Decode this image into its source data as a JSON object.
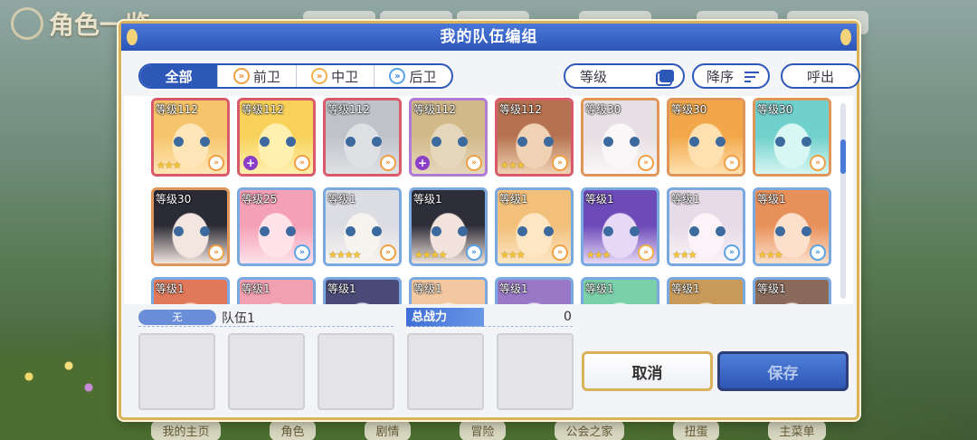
{
  "background": {
    "title": "角色一览",
    "bottom_nav": [
      "我的主页",
      "角色",
      "剧情",
      "冒险",
      "公会之家",
      "扭蛋",
      "主菜单"
    ]
  },
  "dialog": {
    "title": "我的队伍编组",
    "filter_tabs": [
      "全部",
      "前卫",
      "中卫",
      "后卫"
    ],
    "sort_field": "等级",
    "sort_order": "降序",
    "call_button": "呼出",
    "cards": [
      {
        "level": "等级112",
        "stars": "★★★",
        "pos": "front",
        "frame": "red",
        "plus": false
      },
      {
        "level": "等级112",
        "stars": "",
        "pos": "front",
        "frame": "red",
        "plus": true
      },
      {
        "level": "等级112",
        "stars": "",
        "pos": "front",
        "frame": "red",
        "plus": false,
        "dim": true
      },
      {
        "level": "等级112",
        "stars": "",
        "pos": "front",
        "frame": "purple",
        "plus": true,
        "dim": true
      },
      {
        "level": "等级112",
        "stars": "★★★",
        "pos": "front",
        "frame": "red",
        "plus": false
      },
      {
        "level": "等级30",
        "stars": "",
        "pos": "front",
        "frame": "orange",
        "plus": false
      },
      {
        "level": "等级30",
        "stars": "",
        "pos": "front",
        "frame": "orange",
        "plus": false
      },
      {
        "level": "等级30",
        "stars": "",
        "pos": "front",
        "frame": "orange",
        "plus": false
      },
      {
        "level": "等级30",
        "stars": "",
        "pos": "front",
        "frame": "orange",
        "plus": false
      },
      {
        "level": "等级25",
        "stars": "",
        "pos": "back",
        "frame": "blue",
        "plus": false
      },
      {
        "level": "等级1",
        "stars": "★★★★",
        "pos": "front",
        "frame": "blue",
        "plus": false
      },
      {
        "level": "等级1",
        "stars": "★★★★",
        "pos": "back",
        "frame": "blue",
        "plus": false
      },
      {
        "level": "等级1",
        "stars": "★★★",
        "pos": "front",
        "frame": "blue",
        "plus": false
      },
      {
        "level": "等级1",
        "stars": "★★★",
        "pos": "mid",
        "frame": "blue",
        "plus": false
      },
      {
        "level": "等级1",
        "stars": "★★★",
        "pos": "back",
        "frame": "blue",
        "plus": false
      },
      {
        "level": "等级1",
        "stars": "★★★",
        "pos": "back",
        "frame": "blue",
        "plus": false
      },
      {
        "level": "等级1",
        "stars": "",
        "pos": "",
        "frame": "blue",
        "plus": false
      },
      {
        "level": "等级1",
        "stars": "",
        "pos": "",
        "frame": "blue",
        "plus": false
      },
      {
        "level": "等级1",
        "stars": "",
        "pos": "",
        "frame": "blue",
        "plus": false
      },
      {
        "level": "等级1",
        "stars": "",
        "pos": "",
        "frame": "blue",
        "plus": false
      },
      {
        "level": "等级1",
        "stars": "",
        "pos": "",
        "frame": "blue",
        "plus": false
      },
      {
        "level": "等级1",
        "stars": "",
        "pos": "",
        "frame": "blue",
        "plus": false
      },
      {
        "level": "等级1",
        "stars": "",
        "pos": "",
        "frame": "blue",
        "plus": false
      },
      {
        "level": "等级1",
        "stars": "",
        "pos": "",
        "frame": "blue",
        "plus": false
      }
    ],
    "team": {
      "tag": "无",
      "name": "队伍1",
      "power_label": "总战力",
      "power_value": "0"
    },
    "cancel_button": "取消",
    "save_button": "保存"
  },
  "colors": {
    "accent_blue": "#2e58b8",
    "frame_gold": "#d9b25a"
  }
}
